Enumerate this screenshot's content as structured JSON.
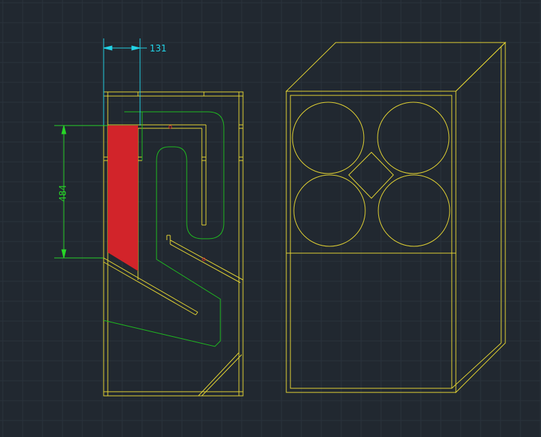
{
  "drawing": {
    "dimension_horizontal": "131",
    "dimension_vertical": "484"
  },
  "colors": {
    "background": "#212830",
    "grid": "#2b333d",
    "grid_major": "#323b46",
    "outline": "#e6d633",
    "path": "#1fbf1f",
    "dimension_cyan": "#22d3e6",
    "dimension_green": "#27d627",
    "highlight_fill": "#d2242a"
  }
}
